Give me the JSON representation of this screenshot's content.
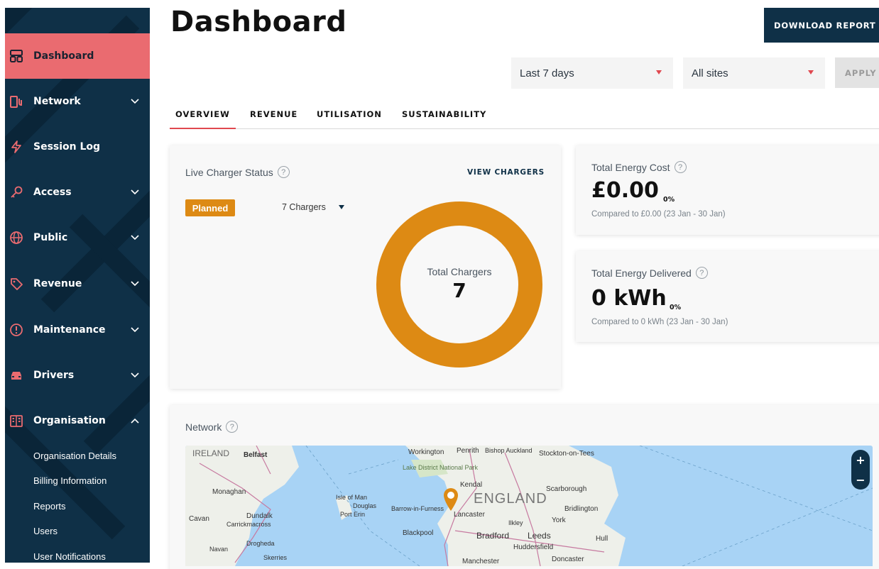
{
  "sidebar": {
    "items": [
      {
        "label": "Dashboard",
        "icon": "dashboard-icon"
      },
      {
        "label": "Network",
        "icon": "charger-icon"
      },
      {
        "label": "Session Log",
        "icon": "lightning-icon"
      },
      {
        "label": "Access",
        "icon": "key-icon"
      },
      {
        "label": "Public",
        "icon": "globe-icon"
      },
      {
        "label": "Revenue",
        "icon": "tag-icon"
      },
      {
        "label": "Maintenance",
        "icon": "alert-icon"
      },
      {
        "label": "Drivers",
        "icon": "car-icon"
      },
      {
        "label": "Organisation",
        "icon": "building-icon"
      }
    ],
    "sub_items": [
      "Organisation Details",
      "Billing Information",
      "Reports",
      "Users",
      "User Notifications"
    ],
    "active_color": "#ea6b70",
    "bg_color": "#0f3047"
  },
  "header": {
    "title": "Dashboard",
    "download_label": "DOWNLOAD REPORT"
  },
  "filters": {
    "period": "Last 7 days",
    "sites": "All sites",
    "apply_label": "APPLY"
  },
  "tabs": [
    "OVERVIEW",
    "REVENUE",
    "UTILISATION",
    "SUSTAINABILITY"
  ],
  "live_status": {
    "title": "Live Charger Status",
    "view_label": "VIEW CHARGERS",
    "badge": "Planned",
    "badge_color": "#dd8a14",
    "selector": "7 Chargers",
    "donut_label": "Total Chargers",
    "donut_value": "7"
  },
  "energy_cost": {
    "title": "Total Energy Cost",
    "value": "£0.00",
    "pct": "0%",
    "compare": "Compared to £0.00 (23 Jan - 30 Jan)"
  },
  "energy_delivered": {
    "title": "Total Energy Delivered",
    "value": "0 kWh",
    "pct": "0%",
    "compare": "Compared to 0 kWh (23 Jan - 30 Jan)"
  },
  "network": {
    "title": "Network",
    "help": "?",
    "map_labels": [
      "IRELAND",
      "Belfast",
      "Monaghan",
      "Cavan",
      "Dundalk",
      "Carrickmacross",
      "Drogheda",
      "Navan",
      "Skerries",
      "Isle of Man",
      "Douglas",
      "Port Erin",
      "Workington",
      "Penrith",
      "Bishop Auckland",
      "Stockton-on-Tees",
      "Lake District National Park",
      "Kendal",
      "ENGLAND",
      "Scarborough",
      "Barrow-in-Furness",
      "Lancaster",
      "Bridlington",
      "York",
      "Ilkley",
      "Blackpool",
      "Bradford",
      "Leeds",
      "Hull",
      "Huddersfield",
      "Doncaster",
      "Manchester"
    ],
    "zoom_in": "+",
    "zoom_out": "−"
  }
}
